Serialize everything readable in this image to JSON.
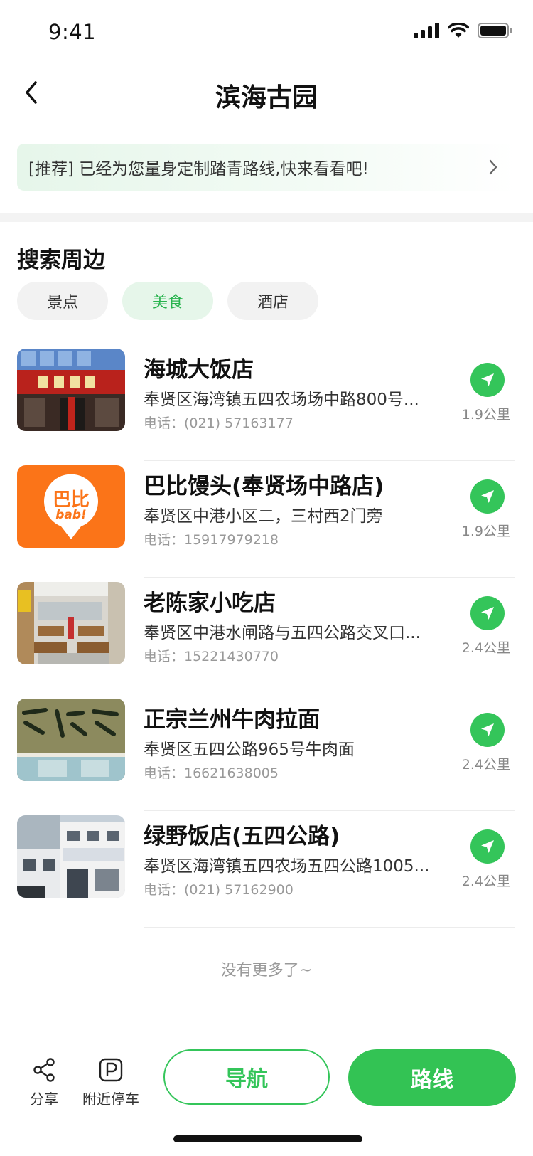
{
  "status_bar": {
    "time": "9:41"
  },
  "header": {
    "title": "滨海古园"
  },
  "banner": {
    "text": "[推荐] 已经为您量身定制踏青路线,快来看看吧!"
  },
  "section": {
    "title": "搜索周边"
  },
  "chips": [
    {
      "label": "景点",
      "active": false
    },
    {
      "label": "美食",
      "active": true
    },
    {
      "label": "酒店",
      "active": false
    }
  ],
  "places": [
    {
      "name": "海城大饭店",
      "address": "奉贤区海湾镇五四农场场中路800号...",
      "phone": "电话：(021) 57163177",
      "distance": "1.9公里"
    },
    {
      "name": "巴比馒头(奉贤场中路店)",
      "address": "奉贤区中港小区二，三村西2门旁",
      "phone": "电话：15917979218",
      "distance": "1.9公里",
      "logo_text_top": "巴比",
      "logo_text_bottom": "bab!"
    },
    {
      "name": "老陈家小吃店",
      "address": "奉贤区中港水闸路与五四公路交叉口...",
      "phone": "电话：15221430770",
      "distance": "2.4公里"
    },
    {
      "name": "正宗兰州牛肉拉面",
      "address": "奉贤区五四公路965号牛肉面",
      "phone": "电话：16621638005",
      "distance": "2.4公里"
    },
    {
      "name": "绿野饭店(五四公路)",
      "address": "奉贤区海湾镇五四农场五四公路1005...",
      "phone": "电话：(021) 57162900",
      "distance": "2.4公里"
    }
  ],
  "list_end": "没有更多了~",
  "bottom_bar": {
    "share_label": "分享",
    "parking_label": "附近停车",
    "navigate_label": "导航",
    "route_label": "路线"
  },
  "colors": {
    "accent": "#34c55a",
    "chip_active_bg": "#e6f6ea",
    "bab_orange": "#fb7418"
  }
}
